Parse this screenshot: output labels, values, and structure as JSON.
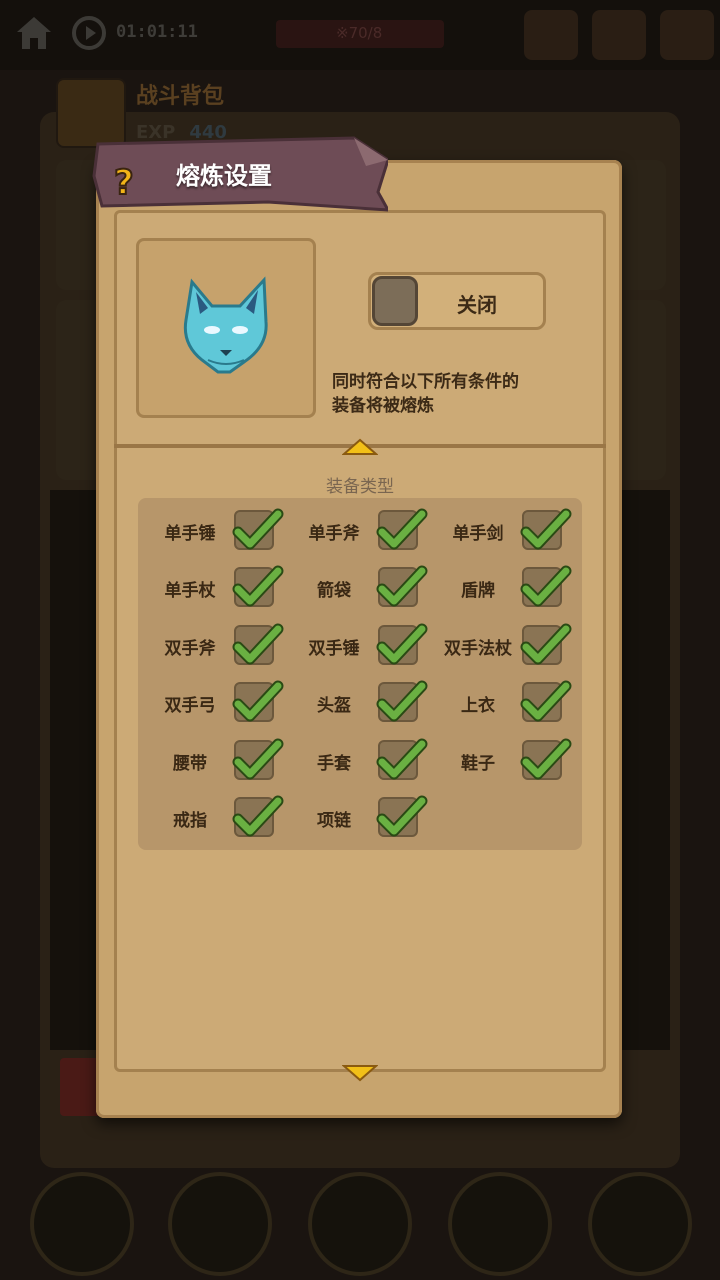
{
  "background": {
    "timer": "01:01:11",
    "top_bar_text": "※70/8",
    "title": "战斗背包",
    "exp_label": "EXP",
    "exp_value": "440"
  },
  "dialog": {
    "title": "熔炼设置",
    "help_icon": "question-mark-icon",
    "toggle_label": "关闭",
    "toggle_state": "off",
    "description_line1": "同时符合以下所有条件的",
    "description_line2": "装备将被熔炼",
    "section_title": "装备类型",
    "colors": {
      "panel": "#c7a46e",
      "banner": "#6e4c56",
      "check": "#6ab042"
    }
  },
  "equipment_types": [
    {
      "label": "单手锤",
      "checked": true
    },
    {
      "label": "单手斧",
      "checked": true
    },
    {
      "label": "单手剑",
      "checked": true
    },
    {
      "label": "单手杖",
      "checked": true
    },
    {
      "label": "箭袋",
      "checked": true
    },
    {
      "label": "盾牌",
      "checked": true
    },
    {
      "label": "双手斧",
      "checked": true
    },
    {
      "label": "双手锤",
      "checked": true
    },
    {
      "label": "双手法杖",
      "checked": true
    },
    {
      "label": "双手弓",
      "checked": true
    },
    {
      "label": "头盔",
      "checked": true
    },
    {
      "label": "上衣",
      "checked": true
    },
    {
      "label": "腰带",
      "checked": true
    },
    {
      "label": "手套",
      "checked": true
    },
    {
      "label": "鞋子",
      "checked": true
    },
    {
      "label": "戒指",
      "checked": true
    },
    {
      "label": "项链",
      "checked": true
    }
  ]
}
